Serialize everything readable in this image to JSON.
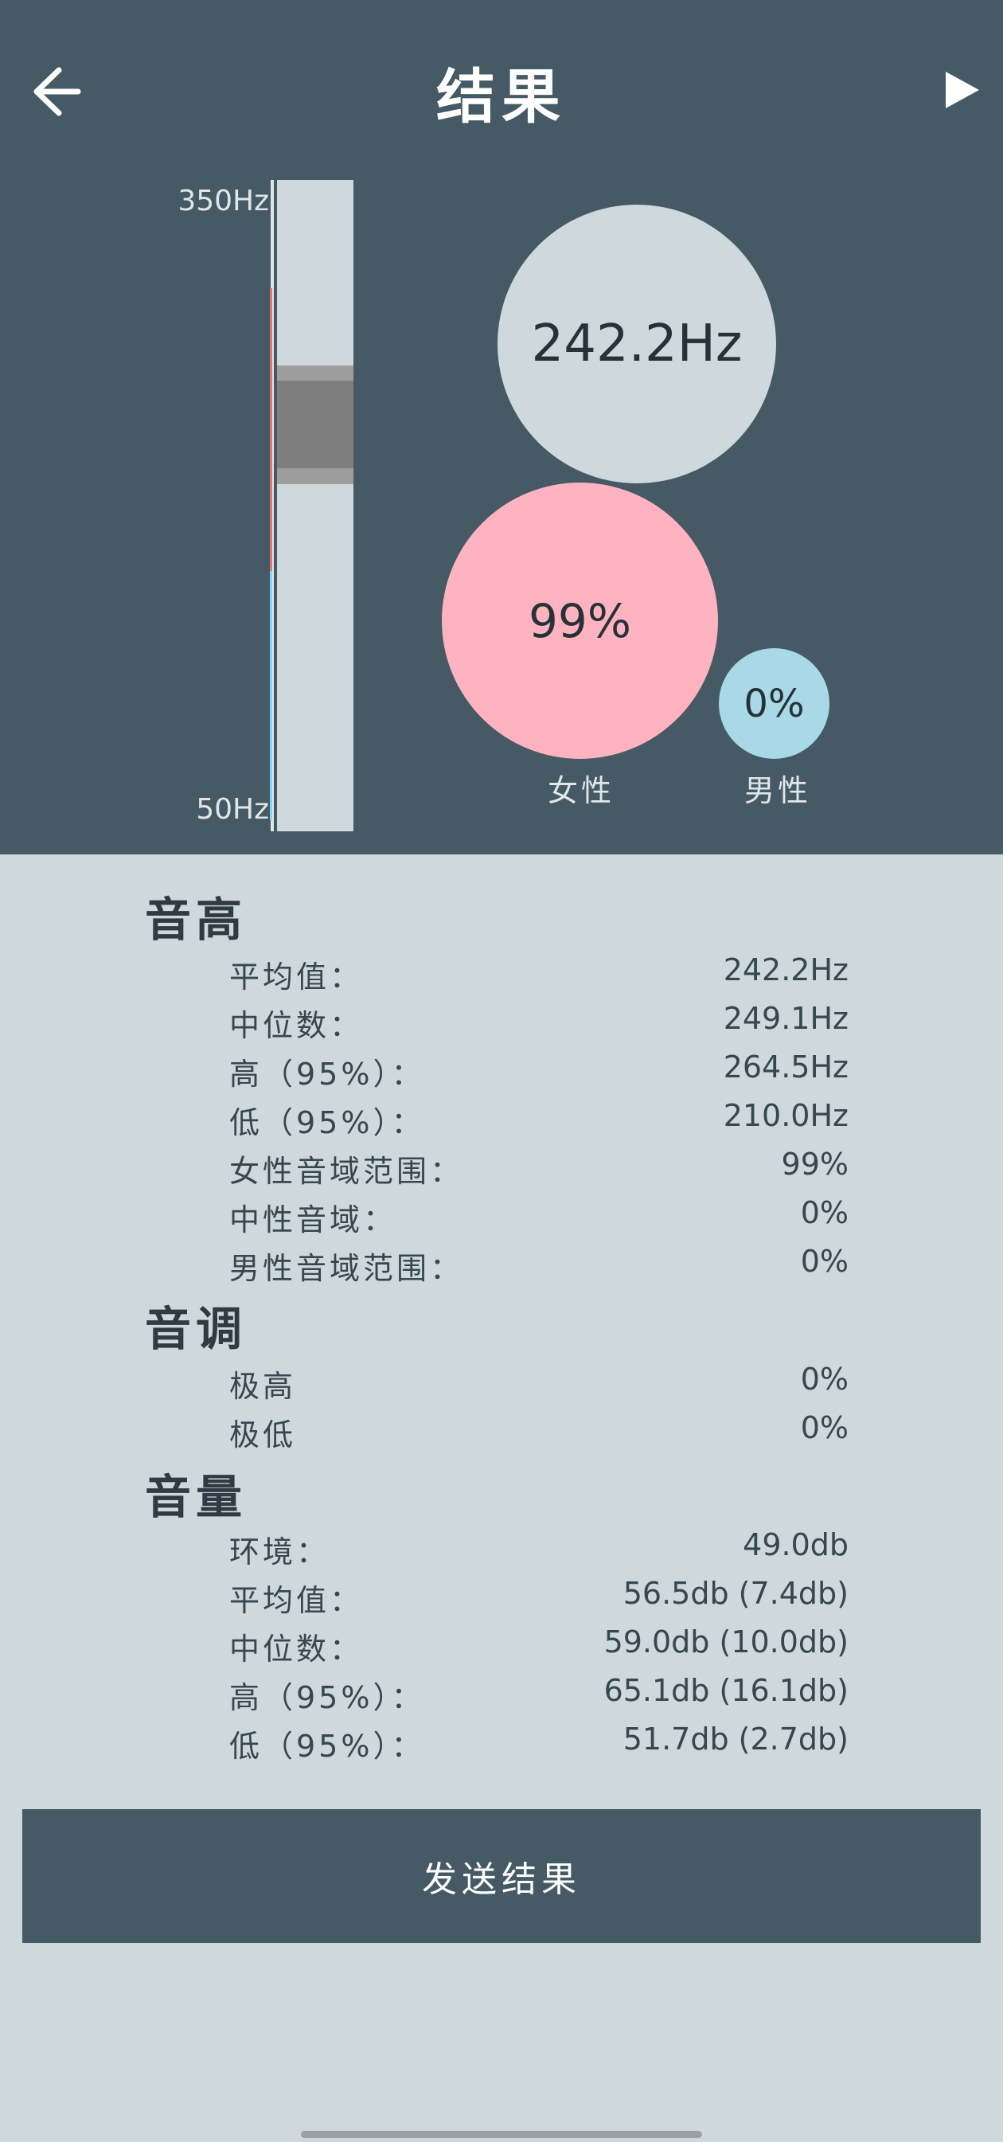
{
  "header": {
    "title": "结果",
    "back_icon": "arrow-left-icon",
    "play_icon": "play-icon"
  },
  "meter": {
    "top_label": "350Hz",
    "bottom_label": "50Hz",
    "range_hz": [
      50,
      350
    ],
    "average_hz": 242.2,
    "band_95_hz": [
      210.0,
      264.5
    ],
    "female_zone_color": "#e57373",
    "male_zone_color": "#81d4fa"
  },
  "summary": {
    "average": "242.2Hz",
    "female_percent": "99%",
    "male_percent": "0%",
    "female_label": "女性",
    "male_label": "男性",
    "colors": {
      "female": "#ffb3c1",
      "male": "#a9d8e6",
      "average": "#cfd8dc"
    }
  },
  "pitch": {
    "title": "音高",
    "rows": [
      {
        "label": "平均值：",
        "value": "242.2Hz"
      },
      {
        "label": "中位数：",
        "value": "249.1Hz"
      },
      {
        "label": "高（95%）：",
        "value": "264.5Hz"
      },
      {
        "label": "低（95%）：",
        "value": "210.0Hz"
      },
      {
        "label": "女性音域范围：",
        "value": "99%"
      },
      {
        "label": "中性音域：",
        "value": "0%"
      },
      {
        "label": "男性音域范围：",
        "value": "0%"
      }
    ]
  },
  "tone": {
    "title": "音调",
    "rows": [
      {
        "label": "极高",
        "value": "0%"
      },
      {
        "label": "极低",
        "value": "0%"
      }
    ]
  },
  "volume": {
    "title": "音量",
    "rows": [
      {
        "label": "环境：",
        "value": "49.0db"
      },
      {
        "label": "平均值：",
        "value": "56.5db (7.4db)"
      },
      {
        "label": "中位数：",
        "value": "59.0db (10.0db)"
      },
      {
        "label": "高（95%）：",
        "value": "65.1db (16.1db)"
      },
      {
        "label": "低（95%）：",
        "value": "51.7db (2.7db)"
      }
    ]
  },
  "send_button": {
    "label": "发送结果"
  }
}
